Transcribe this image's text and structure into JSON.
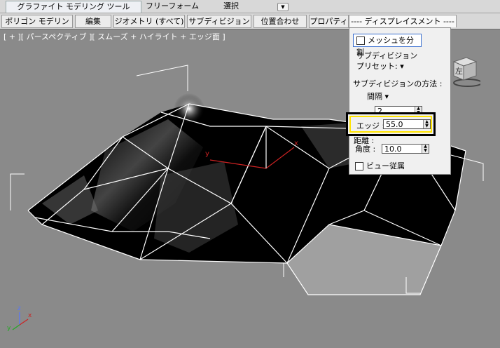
{
  "ribbon": {
    "tabs": [
      "グラファイト モデリング ツール",
      "フリーフォーム",
      "選択"
    ],
    "dropdown_glyph": "▼"
  },
  "panels": [
    "ポリゴン モデリング",
    "編集",
    "ジオメトリ (すべて)",
    "サブディビジョン",
    "位置合わせ",
    "プロパティ",
    "---- ディスプレイスメント ----"
  ],
  "viewport": {
    "label": "[ + ][ パースペクティブ ][ スムーズ + ハイライト + エッジ面 ]",
    "axis_x": "x",
    "axis_y": "y",
    "gizmo_z": "z",
    "gizmo_y": "y",
    "gizmo_x": "x",
    "viewcube_face": "左"
  },
  "displacement": {
    "split_mesh_label": "メッシュを分割",
    "split_mesh_checked": false,
    "subdivision_header": "サブディビジョン",
    "preset_label": "プリセット: ",
    "preset_arrow": "▾",
    "method_header": "サブディビジョンの方法 :",
    "method_value": "間隔",
    "method_arrow": "▾",
    "steps_value": "2",
    "edge_label": "エッジ :",
    "edge_value": "55.0",
    "distance_label": "距離 :",
    "angle_label": "角度 :",
    "angle_value": "10.0",
    "view_dependent_label": "ビュー従属",
    "view_dependent_checked": false
  },
  "colors": {
    "highlight": "#ffe400",
    "viewport_bg": "#8a8a8a",
    "wire": "#ffffff",
    "axis": "#cc2222"
  }
}
